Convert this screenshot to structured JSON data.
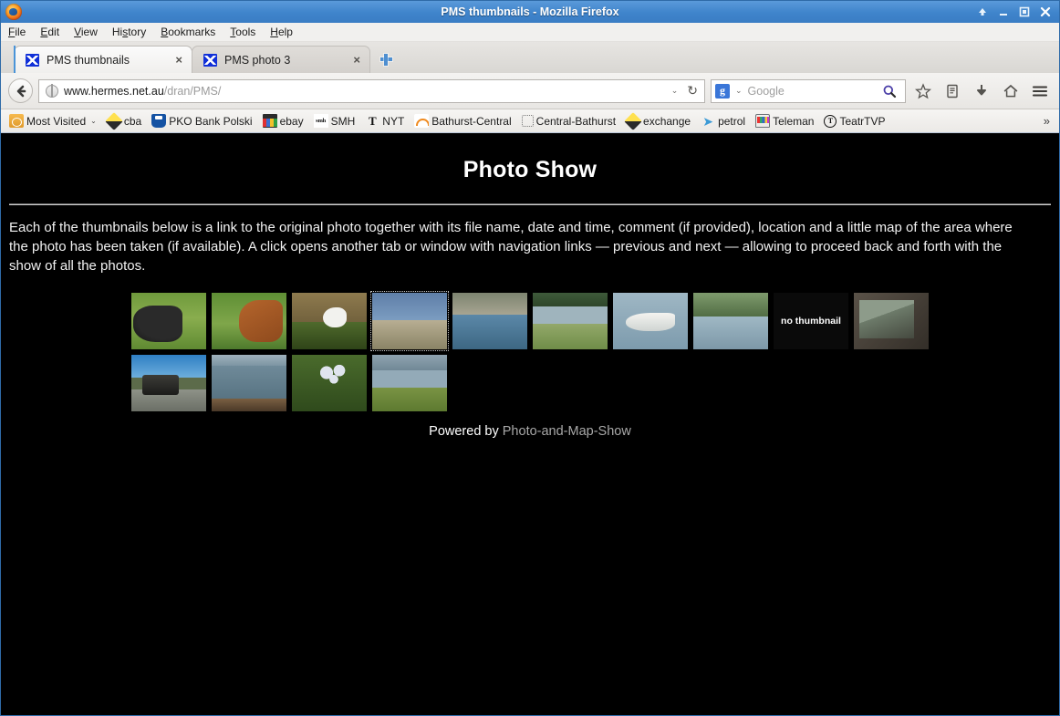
{
  "window": {
    "title": "PMS thumbnails - Mozilla Firefox",
    "controls": {
      "shade": "shade",
      "minimize": "minimize",
      "maximize": "maximize",
      "close": "close"
    }
  },
  "menubar": [
    {
      "label": "File",
      "accel": "F"
    },
    {
      "label": "Edit",
      "accel": "E"
    },
    {
      "label": "View",
      "accel": "V"
    },
    {
      "label": "History",
      "accel": "s"
    },
    {
      "label": "Bookmarks",
      "accel": "B"
    },
    {
      "label": "Tools",
      "accel": "T"
    },
    {
      "label": "Help",
      "accel": "H"
    }
  ],
  "tabs": [
    {
      "label": "PMS thumbnails",
      "active": true,
      "close": "×"
    },
    {
      "label": "PMS photo 3",
      "active": false,
      "close": "×"
    }
  ],
  "newtab_label": "+",
  "navbar": {
    "back_icon": "back-arrow-icon",
    "url_domain": "www.hermes.net.au",
    "url_path": "/dran/PMS/",
    "dropdown_caret": "⌄",
    "reload_icon": "↻",
    "search_engine": "g",
    "search_placeholder": "Google",
    "icons": [
      "magnifier-icon",
      "star-icon",
      "reader-icon",
      "download-icon",
      "home-icon",
      "menu-icon"
    ]
  },
  "bookmarks": {
    "items": [
      {
        "label": "Most Visited",
        "icon": "folder-icon",
        "chevron": "⌄"
      },
      {
        "label": "cba",
        "icon": "diamond-icon"
      },
      {
        "label": "PKO Bank Polski",
        "icon": "pko-icon"
      },
      {
        "label": "ebay",
        "icon": "ebay-icon"
      },
      {
        "label": "SMH",
        "icon": "smh-icon",
        "icon_text": "smh"
      },
      {
        "label": "NYT",
        "icon": "nyt-icon",
        "icon_text": "T"
      },
      {
        "label": "Bathurst-Central",
        "icon": "rainbow-icon"
      },
      {
        "label": "Central-Bathurst",
        "icon": "placeholder-icon"
      },
      {
        "label": "exchange",
        "icon": "diamond-icon"
      },
      {
        "label": "petrol",
        "icon": "bird-icon",
        "icon_text": "➤"
      },
      {
        "label": "Teleman",
        "icon": "tv-icon"
      },
      {
        "label": "TeatrTVP",
        "icon": "teatr-icon",
        "icon_text": "T"
      }
    ],
    "overflow": "»"
  },
  "page": {
    "title": "Photo Show",
    "intro": "Each of the thumbnails below is a link to the original photo together with its file name, date and time, comment (if provided), location and a little map of the area where the photo has been taken (if available). A click opens another tab or window with navigation links — previous and next — allowing to proceed back and forth with the show of all the photos.",
    "thumbnails": [
      {
        "alt": "black cow in green paddock",
        "art": "t-cow",
        "focused": false,
        "placeholder": false
      },
      {
        "alt": "brown horse by fence",
        "art": "t-horse",
        "focused": false,
        "placeholder": false
      },
      {
        "alt": "seagull on shore",
        "art": "t-gull",
        "focused": false,
        "placeholder": false
      },
      {
        "alt": "flock of birds over water",
        "art": "t-birds",
        "focused": true,
        "placeholder": false
      },
      {
        "alt": "birds on sandy shoreline",
        "art": "t-shore",
        "focused": false,
        "placeholder": false
      },
      {
        "alt": "lake with birds",
        "art": "t-lake",
        "focused": false,
        "placeholder": false
      },
      {
        "alt": "pelican on water",
        "art": "t-pelican",
        "focused": false,
        "placeholder": false
      },
      {
        "alt": "pelicans on lake with trees",
        "art": "t-pelicans",
        "focused": false,
        "placeholder": false
      },
      {
        "alt": "no thumbnail",
        "art": "",
        "focused": false,
        "placeholder": true,
        "placeholder_text": "no thumbnail"
      },
      {
        "alt": "room interior with desk",
        "art": "t-room",
        "focused": false,
        "placeholder": false
      },
      {
        "alt": "vehicle on road under blue sky",
        "art": "t-car",
        "focused": false,
        "placeholder": false
      },
      {
        "alt": "harbour water view",
        "art": "t-harbour",
        "focused": false,
        "placeholder": false
      },
      {
        "alt": "white flowers in greenery",
        "art": "t-flowers",
        "focused": false,
        "placeholder": false
      },
      {
        "alt": "harbour with green lawn",
        "art": "t-lawn",
        "focused": false,
        "placeholder": false
      }
    ],
    "footer_prefix": "Powered by ",
    "footer_link": "Photo-and-Map-Show"
  }
}
